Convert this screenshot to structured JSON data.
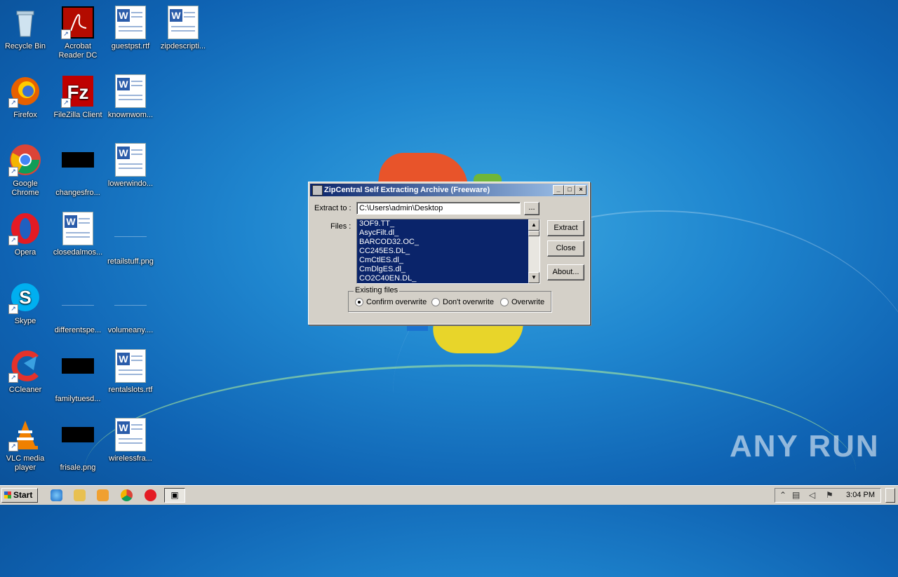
{
  "desktop_icons": [
    {
      "label": "Recycle Bin"
    },
    {
      "label": "Acrobat Reader DC"
    },
    {
      "label": "guestpst.rtf"
    },
    {
      "label": "zipdescripti..."
    },
    {
      "label": "Firefox"
    },
    {
      "label": "FileZilla Client"
    },
    {
      "label": "knownwom..."
    },
    {
      "label": "Google Chrome"
    },
    {
      "label": "changesfro..."
    },
    {
      "label": "lowerwindo..."
    },
    {
      "label": "Opera"
    },
    {
      "label": "closedalmos..."
    },
    {
      "label": "retailstuff.png"
    },
    {
      "label": "Skype"
    },
    {
      "label": "differentspe..."
    },
    {
      "label": "volumeany...."
    },
    {
      "label": "CCleaner"
    },
    {
      "label": "familytuesd..."
    },
    {
      "label": "rentalslots.rtf"
    },
    {
      "label": "VLC media player"
    },
    {
      "label": "frisale.png"
    },
    {
      "label": "wirelessfra..."
    }
  ],
  "dialog": {
    "title": "ZipCentral Self Extracting Archive (Freeware)",
    "extract_to_label": "Extract to :",
    "extract_to_value": "C:\\Users\\admin\\Desktop",
    "browse_label": "...",
    "files_label": "Files :",
    "files": [
      "3OF9.TT_",
      "AsycFilt.dl_",
      "BARCOD32.OC_",
      "CC245ES.DL_",
      "CmCtlES.dl_",
      "CmDlgES.dl_",
      "CO2C40EN.DL_"
    ],
    "extract_button": "Extract",
    "close_button": "Close",
    "about_button": "About...",
    "existing_files_label": "Existing files",
    "options": [
      "Confirm overwrite",
      "Don't overwrite",
      "Overwrite"
    ],
    "selected_option": "Confirm overwrite"
  },
  "taskbar": {
    "start_label": "Start",
    "clock": "3:04 PM"
  },
  "watermark": "ANY RUN"
}
